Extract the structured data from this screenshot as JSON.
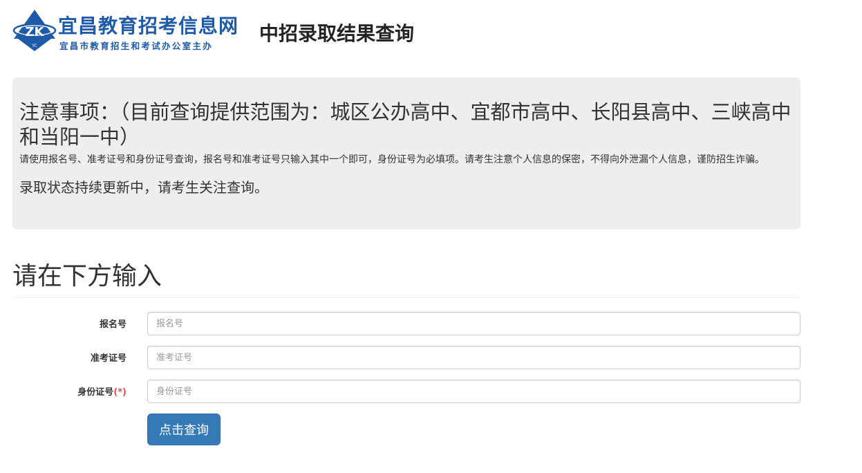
{
  "header": {
    "logo": {
      "title": "宜昌教育招考信息网",
      "subtitle": "宜昌市教育招生和考试办公室主办",
      "emblem_letters": "ZK",
      "emblem_small": "YC",
      "brand_color": "#1f5aa8"
    },
    "page_title": "中招录取结果查询"
  },
  "notice": {
    "title": "注意事项：（目前查询提供范围为：城区公办高中、宜都市高中、长阳县高中、三峡高中和当阳一中）",
    "text": "请使用报名号、准考证号和身份证号查询，报名号和准考证号只输入其中一个即可，身份证号为必填项。请考生注意个人信息的保密，不得向外泄漏个人信息，谨防招生诈骗。",
    "status": "录取状态持续更新中，请考生关注查询。"
  },
  "form": {
    "section_title": "请在下方输入",
    "fields": [
      {
        "label": "报名号",
        "placeholder": "报名号",
        "value": ""
      },
      {
        "label": "准考证号",
        "placeholder": "准考证号",
        "value": ""
      },
      {
        "label": "身份证号",
        "required_mark": "(*)",
        "placeholder": "身份证号",
        "value": ""
      }
    ],
    "submit_label": "点击查询",
    "accent_color": "#337ab7"
  }
}
